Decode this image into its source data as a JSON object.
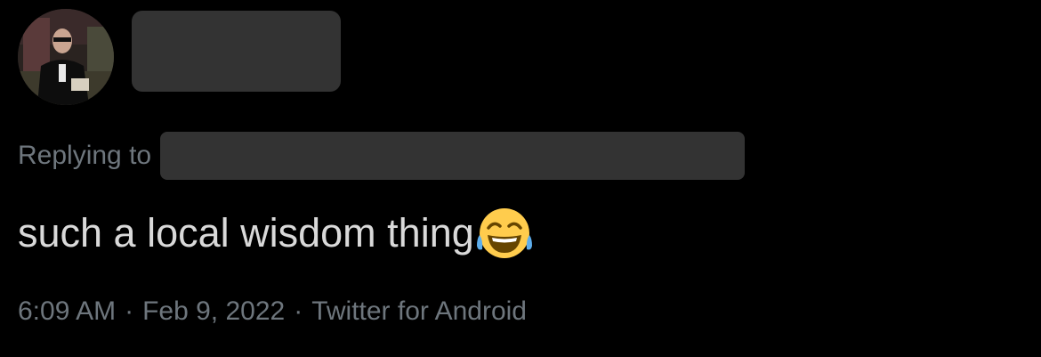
{
  "tweet": {
    "author": {
      "avatar_icon": "profile-photo-avatar"
    },
    "replying_to_label": "Replying to",
    "text": "such a local wisdom thing",
    "emoji": "face-with-tears-of-joy",
    "meta": {
      "time": "6:09 AM",
      "separator": "·",
      "date": "Feb 9, 2022",
      "source": "Twitter for Android"
    }
  },
  "colors": {
    "background": "#000000",
    "primary_text": "#d9d9d9",
    "secondary_text": "#6e767d",
    "redaction": "#333333"
  }
}
